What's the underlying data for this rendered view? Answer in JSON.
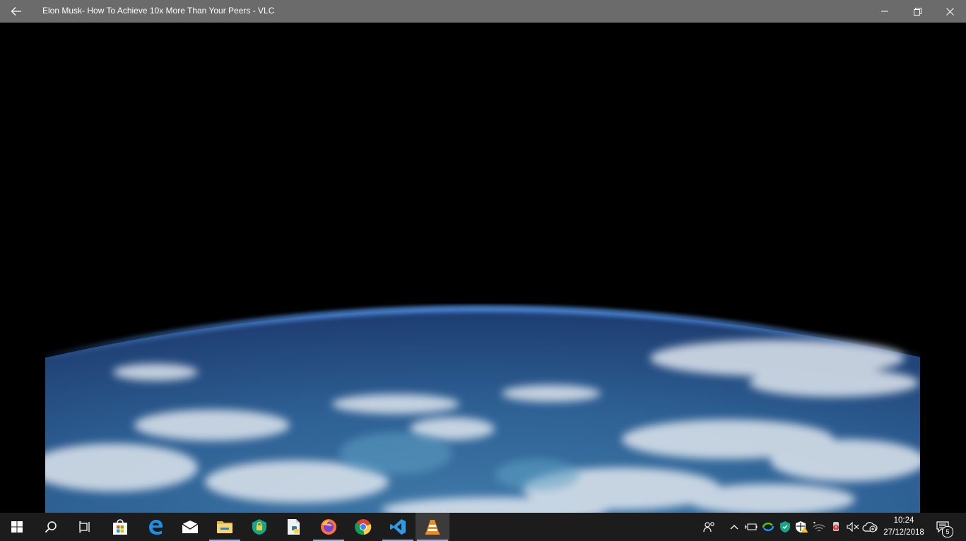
{
  "window": {
    "title": "Elon Musk- How To Achieve 10x More Than Your Peers - VLC",
    "back_icon": "arrow-left-icon",
    "controls": [
      "minimize-icon",
      "restore-icon",
      "close-icon"
    ]
  },
  "video": {
    "scene": "earth-from-orbit"
  },
  "taskbar": {
    "apps": [
      {
        "icon": "windows-start-icon"
      },
      {
        "icon": "search-icon"
      },
      {
        "icon": "task-view-icon"
      },
      {
        "icon": "microsoft-store-icon"
      },
      {
        "icon": "edge-browser-icon"
      },
      {
        "icon": "mail-icon"
      },
      {
        "icon": "file-explorer-icon"
      },
      {
        "icon": "security-shield-icon"
      },
      {
        "icon": "python-file-icon"
      },
      {
        "icon": "firefox-icon"
      },
      {
        "icon": "chrome-icon"
      },
      {
        "icon": "vscode-icon"
      },
      {
        "icon": "vlc-icon"
      }
    ],
    "tray_icons": [
      "people-icon",
      "chevron-up-icon",
      "battery-icon",
      "sync-icon",
      "defender-icon",
      "security-alert-icon",
      "wifi-icon",
      "usb-alert-icon",
      "volume-muted-icon",
      "onedrive-icon"
    ],
    "clock": {
      "time": "10:24",
      "date": "27/12/2018"
    },
    "notifications": {
      "icon": "action-center-icon",
      "count": "5"
    }
  }
}
